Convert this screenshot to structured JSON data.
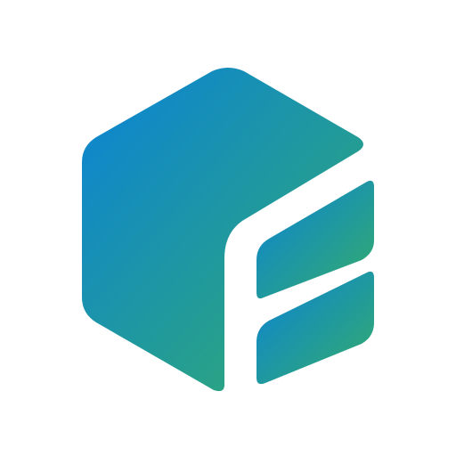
{
  "logo": {
    "icon_name": "hexagon-cube-f-icon",
    "background_color": "#ffffff",
    "gradient_start": "#0a82d8",
    "gradient_end": "#34ad6a"
  }
}
